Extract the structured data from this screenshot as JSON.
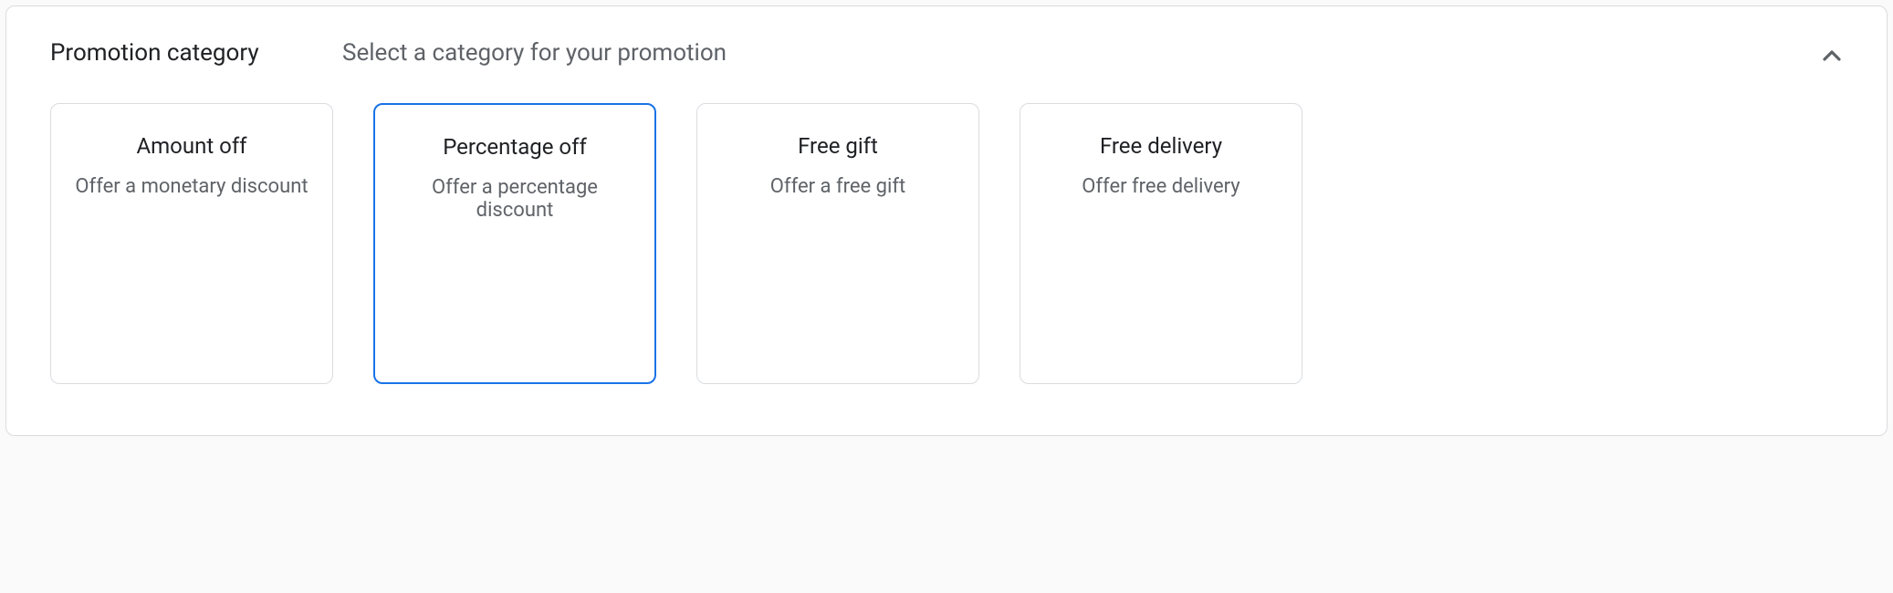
{
  "section": {
    "label": "Promotion category",
    "hint": "Select a category for your promotion"
  },
  "cards": [
    {
      "title": "Amount off",
      "desc": "Offer a monetary discount",
      "selected": false
    },
    {
      "title": "Percentage off",
      "desc": "Offer a percentage discount",
      "selected": true
    },
    {
      "title": "Free gift",
      "desc": "Offer a free gift",
      "selected": false
    },
    {
      "title": "Free delivery",
      "desc": "Offer free delivery",
      "selected": false
    }
  ]
}
